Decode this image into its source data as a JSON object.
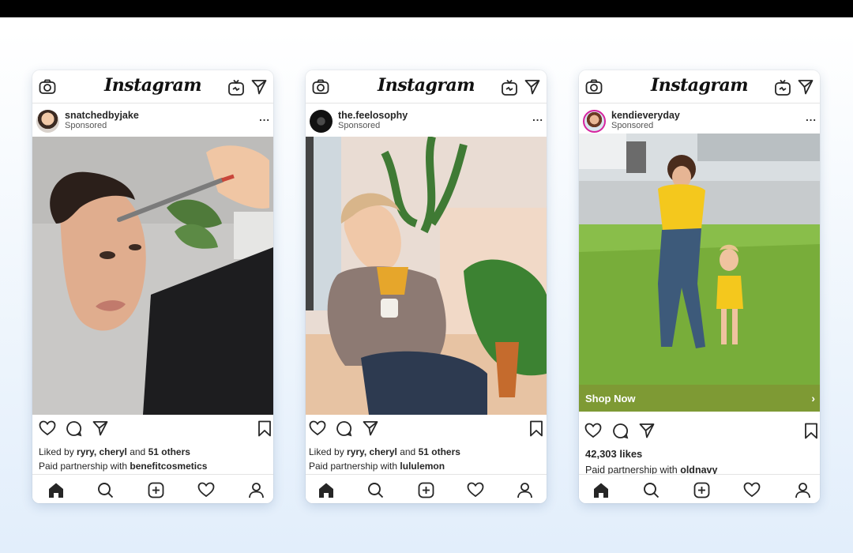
{
  "app_name": "Instagram",
  "ui": {
    "sponsored_label": "Sponsored",
    "liked_by_prefix": "Liked by ",
    "and_label": " and ",
    "partnership_prefix": "Paid partnership with ",
    "more_label": "..."
  },
  "posts": [
    {
      "username": "snatchedbyjake",
      "liked_by_users": "ryry, cheryl",
      "liked_by_others": "51 others",
      "partner": "benefitcosmetics"
    },
    {
      "username": "the.feelosophy",
      "liked_by_users": "ryry, cheryl",
      "liked_by_others": "51 others",
      "partner": "lululemon"
    },
    {
      "username": "kendieveryday",
      "likes": "42,303 likes",
      "partner": "oldnavy",
      "cta_label": "Shop Now",
      "cta_chevron": "›"
    }
  ],
  "icons": [
    "camera-icon",
    "igtv-icon",
    "direct-send-icon",
    "more-options-icon",
    "heart-icon",
    "comment-icon",
    "share-icon",
    "bookmark-icon",
    "home-icon",
    "search-icon",
    "add-post-icon",
    "activity-heart-icon",
    "profile-icon"
  ],
  "colors": {
    "shop_now_bar": "#7e9a34",
    "story_ring": "#d6249f",
    "text": "#262626"
  }
}
